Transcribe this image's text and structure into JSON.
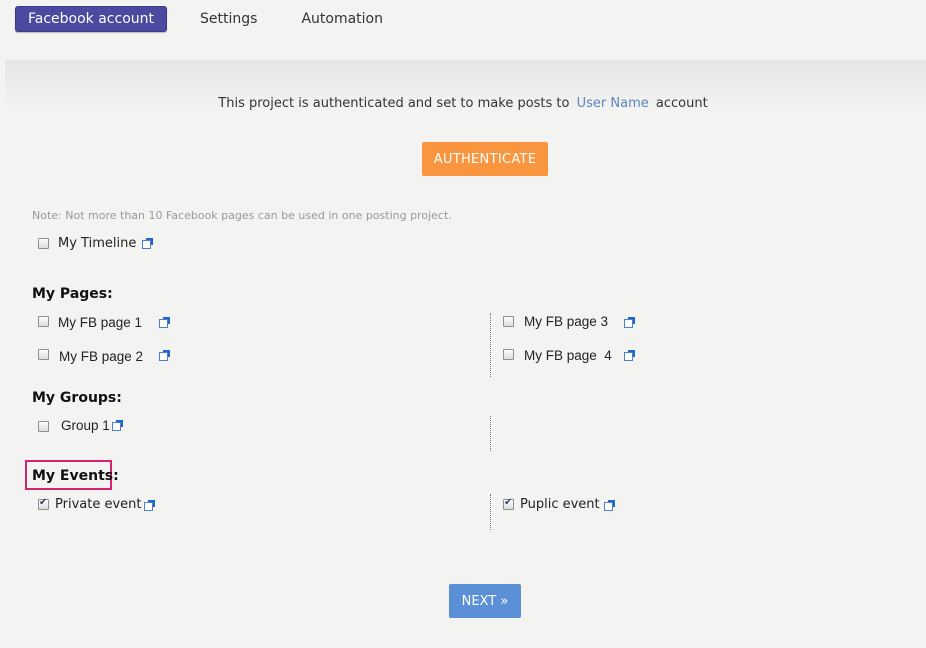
{
  "tabs": [
    {
      "label": "Facebook account",
      "active": true
    },
    {
      "label": "Settings",
      "active": false
    },
    {
      "label": "Automation",
      "active": false
    }
  ],
  "auth": {
    "text_before": "This project is authenticated and set to make posts to",
    "user_name": "User Name",
    "text_after": "account",
    "button_label": "AUTHENTICATE"
  },
  "note": "Note: Not more than 10 Facebook pages can be used in one posting project.",
  "timeline": {
    "label": "My Timeline",
    "checked": false
  },
  "pages": {
    "heading": "My Pages:",
    "items": [
      {
        "label": "My FB page 1",
        "checked": false
      },
      {
        "label": "My FB page 2",
        "checked": false
      },
      {
        "label": "My FB page 3",
        "checked": false
      },
      {
        "label": "My FB page  4",
        "checked": false
      }
    ]
  },
  "groups": {
    "heading": "My Groups:",
    "items": [
      {
        "label": "Group 1",
        "checked": false
      }
    ]
  },
  "events": {
    "heading": "My Events:",
    "items": [
      {
        "label": "Private event",
        "checked": true
      },
      {
        "label": "Puplic event",
        "checked": true
      }
    ]
  },
  "next_label": "NEXT »",
  "colors": {
    "tab_active": "#4a4aa0",
    "authenticate": "#f8953e",
    "next": "#5b8fd6",
    "highlight": "#d6226f",
    "link": "#5b84c4"
  }
}
